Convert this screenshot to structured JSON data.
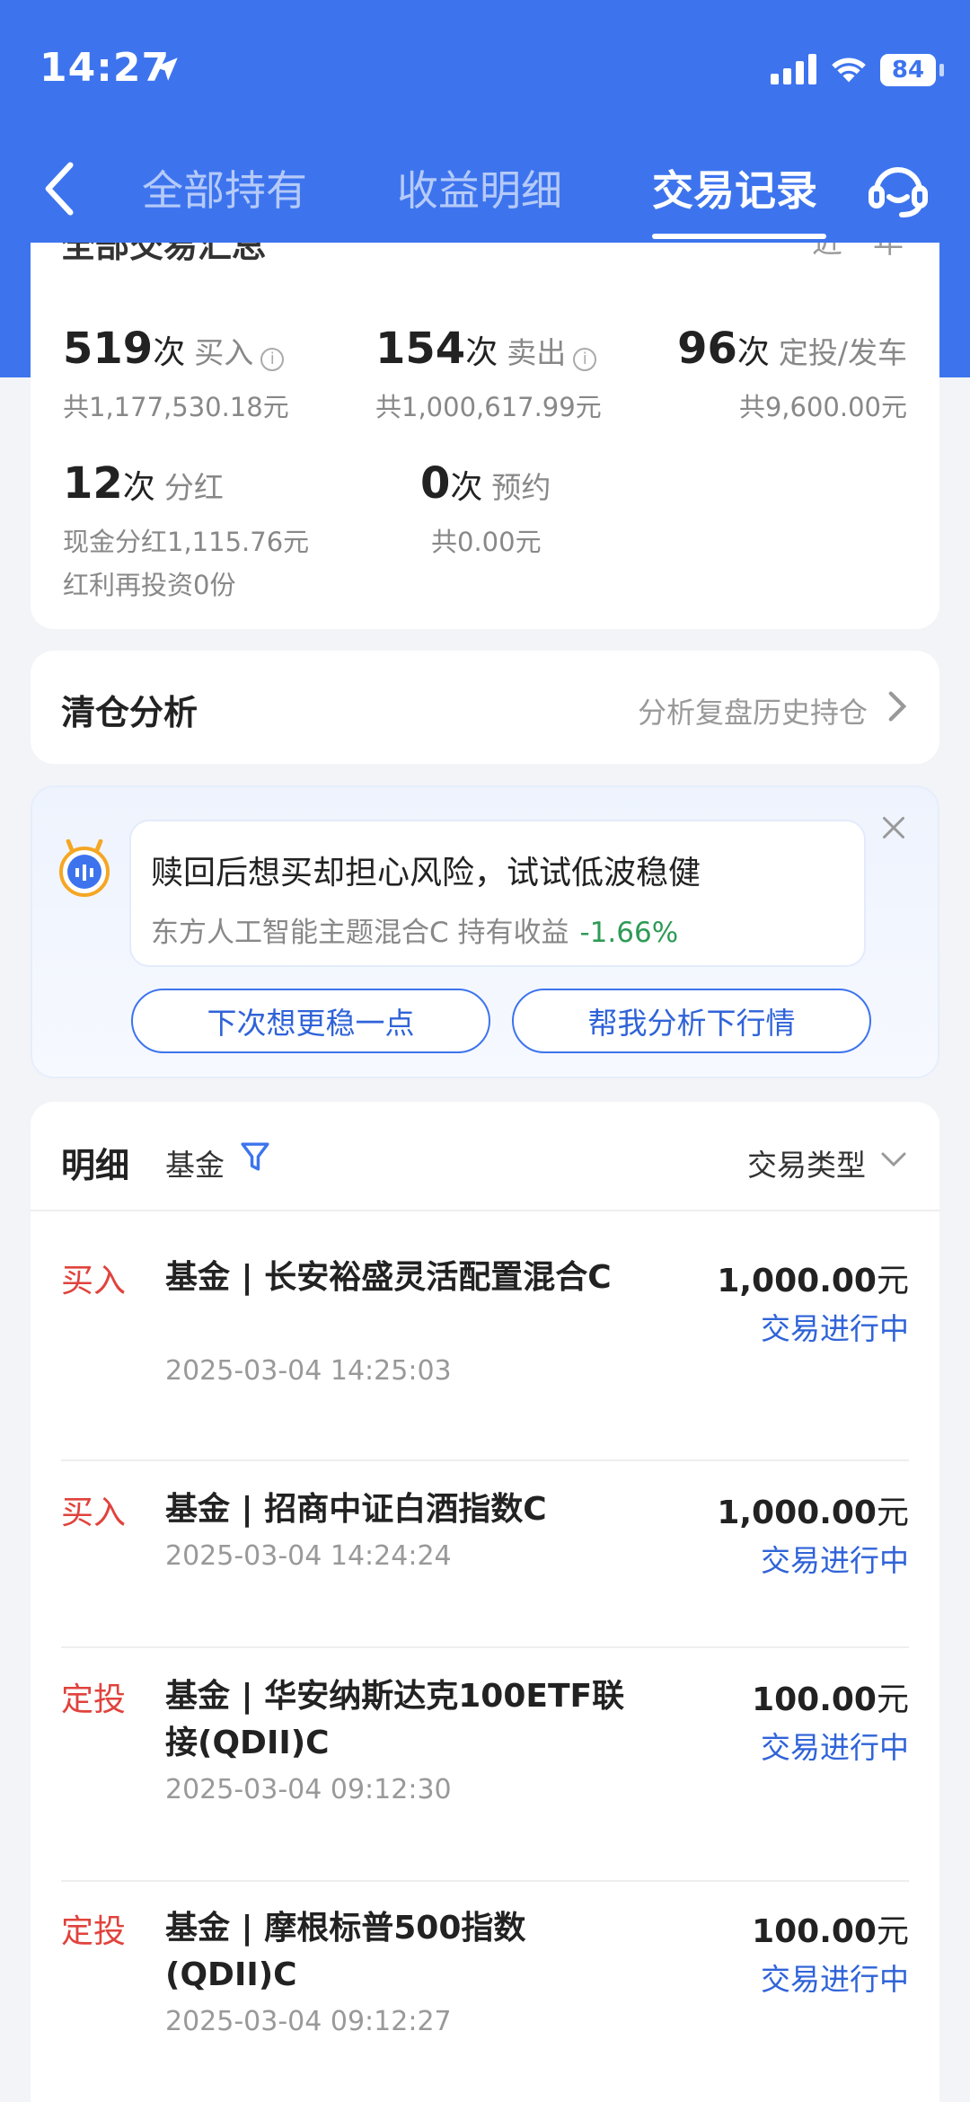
{
  "status_bar": {
    "time": "14:27",
    "battery": "84"
  },
  "nav": {
    "tabs": [
      "全部持有",
      "收益明细",
      "交易记录"
    ],
    "active_tab": "交易记录"
  },
  "summary": {
    "title": "全部交易汇总",
    "range": "近一年",
    "stats": [
      {
        "count": "519",
        "unit": "次",
        "label": "买入",
        "sub": "共1,177,530.18元"
      },
      {
        "count": "154",
        "unit": "次",
        "label": "卖出",
        "sub": "共1,000,617.99元"
      },
      {
        "count": "96",
        "unit": "次",
        "label": "定投/发车",
        "sub": "共9,600.00元"
      },
      {
        "count": "12",
        "unit": "次",
        "label": "分红",
        "sub": "现金分红1,115.76元",
        "sub2": "红利再投资0份"
      },
      {
        "count": "0",
        "unit": "次",
        "label": "预约",
        "sub": "共0.00元"
      }
    ]
  },
  "clearance": {
    "title": "清仓分析",
    "link": "分析复盘历史持仓"
  },
  "promo": {
    "title": "赎回后想买却担心风险，试试低波稳健",
    "fund": "东方人工智能主题混合C 持有收益",
    "pct": "-1.66%",
    "btn1": "下次想更稳一点",
    "btn2": "帮我分析下行情"
  },
  "detail": {
    "title": "明细",
    "filter": "基金",
    "type_select": "交易类型",
    "rows": [
      {
        "kind": "买入",
        "name": "基金 | 长安裕盛灵活配置混合C",
        "date": "2025-03-04 14:25:03",
        "amount": "1,000.00",
        "status": "交易进行中"
      },
      {
        "kind": "买入",
        "name": "基金 | 招商中证白酒指数C",
        "date": "2025-03-04 14:24:24",
        "amount": "1,000.00",
        "status": "交易进行中"
      },
      {
        "kind": "定投",
        "name": "基金 | 华安纳斯达克100ETF联接(QDII)C",
        "date": "2025-03-04 09:12:30",
        "amount": "100.00",
        "status": "交易进行中"
      },
      {
        "kind": "定投",
        "name": "基金 | 摩根标普500指数(QDII)C",
        "date": "2025-03-04 09:12:27",
        "amount": "100.00",
        "status": "交易进行中"
      }
    ],
    "currency": "元"
  }
}
